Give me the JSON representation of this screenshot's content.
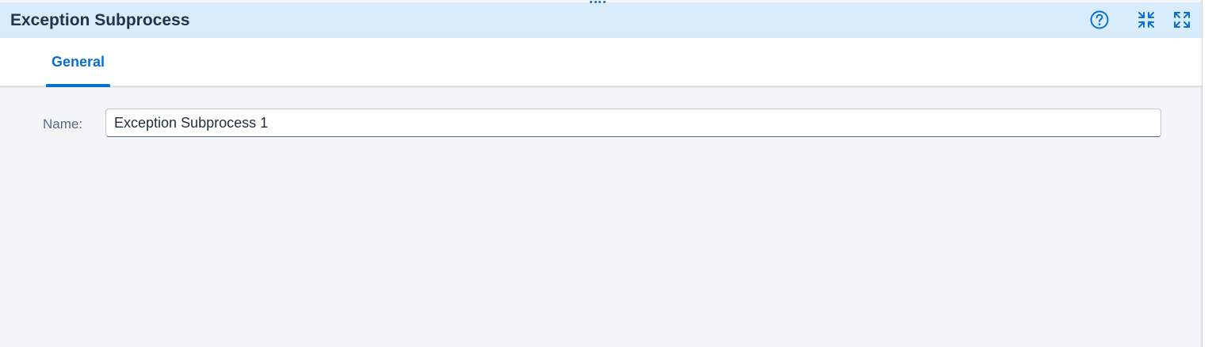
{
  "dialog": {
    "title": "Exception Subprocess",
    "header_icons": [
      {
        "name": "help-icon",
        "glyph": "?"
      },
      {
        "name": "exit-fullscreen-icon"
      },
      {
        "name": "fullscreen-icon"
      }
    ]
  },
  "tabs": [
    {
      "label": "General",
      "selected": true
    }
  ],
  "form": {
    "name_label": "Name:",
    "name_value": "Exception Subprocess 1"
  },
  "colors": {
    "header_bg": "#d9ecfb",
    "accent": "#0a6ed1",
    "title_text": "#223548",
    "label_text": "#556b82",
    "content_bg": "#f4f5f7"
  }
}
